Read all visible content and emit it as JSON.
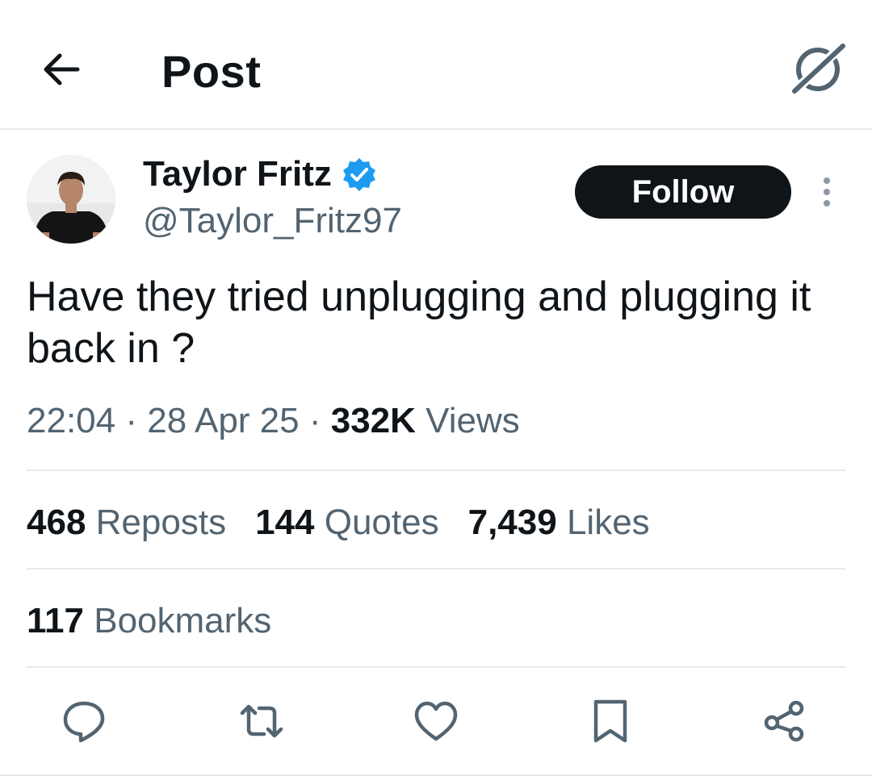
{
  "header": {
    "title": "Post",
    "back_icon": "arrow-left-icon",
    "grok_icon": "grok-icon"
  },
  "author": {
    "display_name": "Taylor Fritz",
    "handle": "@Taylor_Fritz97",
    "verified": true,
    "verified_color": "#1d9bf0",
    "follow_label": "Follow"
  },
  "tweet": {
    "text": "Have they tried unplugging and plugging it back in ?",
    "time": "22:04",
    "date": "28 Apr 25",
    "views_count": "332K",
    "views_label": "Views",
    "separator": "·"
  },
  "stats": [
    {
      "count": "468",
      "label": "Reposts"
    },
    {
      "count": "144",
      "label": "Quotes"
    },
    {
      "count": "7,439",
      "label": "Likes"
    }
  ],
  "bookmarks": {
    "count": "117",
    "label": "Bookmarks"
  },
  "actions": [
    "reply-icon",
    "repost-icon",
    "like-icon",
    "bookmark-icon",
    "share-icon"
  ],
  "colors": {
    "text": "#0f1419",
    "secondary": "#536471",
    "divider": "#e6e9ec",
    "follow_bg": "#0f1419"
  }
}
